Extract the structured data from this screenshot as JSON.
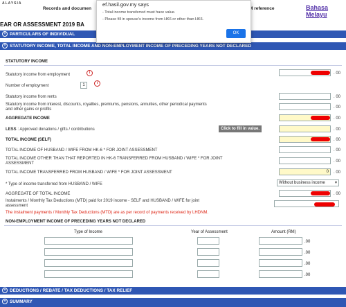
{
  "header": {
    "country_fragment": "ALAYSIA",
    "nav_left": "Records and documen",
    "nav_right": "M reference",
    "lang_line1": "Bahasa",
    "lang_line2": "Melayu",
    "page_title": "EAR OR ASSESSMENT 2019 BA"
  },
  "dialog": {
    "origin": "ef.hasil.gov.my says",
    "line1": "- Total income transferred must have value.",
    "line2": "- Please fill in spouse's income from HK6 or other than HK6.",
    "ok": "OK"
  },
  "sections": {
    "particulars": "PARTICULARS OF INDIVIDUAL",
    "statutory": "STATUTORY INCOME, TOTAL INCOME AND NON-EMPLOYMENT INCOME OF PRECEDING YEARS NOT DECLARED",
    "deductions": "DEDUCTIONS / REBATE / TAX DEDUCTIONS / TAX RELIEF",
    "summary": "SUMMARY",
    "expand_icon": "plus-circle-icon"
  },
  "statutory_block": {
    "heading": "STATUTORY INCOME",
    "employment": "Statutory income from employment",
    "num_employment_label": "Number of employment",
    "num_employment_value": "1",
    "rents": "Statutory income from rents",
    "interest_line1": "Statutory income from interest, discounts, royalties, premiums, pensions, annuities, other periodical payments",
    "interest_line2": "and other gains or profits",
    "aggregate": "AGGREGATE INCOME",
    "less": "LESS",
    "less_rest": ": Approved donations / gifts / contributions",
    "click_fill": "Click to fill in value.",
    "total_self": "TOTAL INCOME (SELF)",
    "total_hk6": "TOTAL INCOME OF HUSBAND / WIFE FROM HK-6 * FOR JOINT ASSESSMENT",
    "total_other_line1": "TOTAL INCOME OTHER THAN THAT REPORTED IN HK-6 TRANSFERRED FROM HUSBAND / WIFE * FOR JOINT",
    "total_other_line2": "ASSESSMENT",
    "transferred": "TOTAL INCOME TRANSFERRED FROM HUSBAND / WIFE * FOR JOINT ASSESSMENT",
    "transferred_value": "0",
    "type_label": "* Type of income transferred from HUSBAND / WIFE",
    "type_value": "Without business income",
    "aggregate_total": "AGGREGATE OF TOTAL INCOME",
    "mtd_line1": "Instalments / Monthly Tax Deductions (MTD) paid for 2019 income - SELF and HUSBAND / WIFE for joint",
    "mtd_line2": "assessment",
    "mtd_note": "The instalment payments / Monthly Tax Deductions (MTD) are as per record of payments received by LHDNM.",
    "decimal": ". 00"
  },
  "non_employment": {
    "heading": "NON-EMPLOYMENT INCOME OF PRECEDING YEARS NOT DECLARED",
    "col_type": "Type of Income",
    "col_year": "Year of Assessment",
    "col_amount": "Amount (RM)",
    "decimal": ".00"
  },
  "colors": {
    "bar": "#2f57b4",
    "redaction": "#e00000",
    "yellow": "#fff9c8"
  }
}
